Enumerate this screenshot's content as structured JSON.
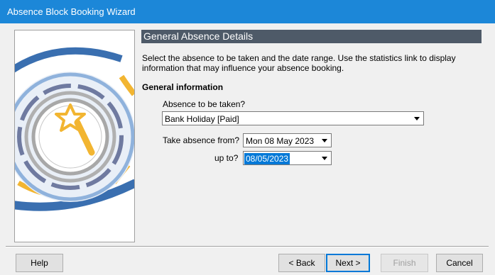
{
  "window": {
    "title": "Absence Block Booking Wizard"
  },
  "heading": "General Absence Details",
  "intro": "Select the absence to be taken and the date range.   Use the statistics link to display information that may influence your absence booking.",
  "section_title": "General information",
  "absence": {
    "label": "Absence to be taken?",
    "value": "Bank Holiday [Paid]"
  },
  "from": {
    "label": "Take absence from?",
    "value": "Mon 08 May 2023"
  },
  "upto": {
    "label": "up to?",
    "value": "08/05/2023"
  },
  "buttons": {
    "help": "Help",
    "back": "< Back",
    "next": "Next >",
    "finish": "Finish",
    "cancel": "Cancel"
  },
  "colors": {
    "titlebar": "#1c87d8",
    "heading_bar": "#4e5a68",
    "accent_yellow": "#f2b531",
    "accent_blue": "#3a6fb0"
  }
}
